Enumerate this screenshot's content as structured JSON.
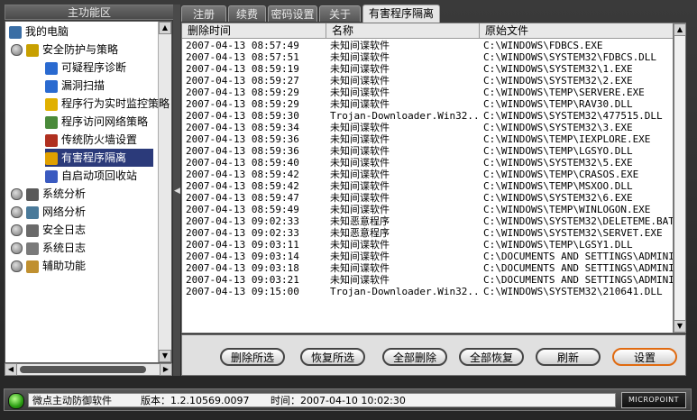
{
  "left_panel": {
    "title": "主功能区",
    "tree": [
      {
        "label": "我的电脑",
        "level": 0,
        "icon": "computer-icon",
        "name": "tree-item-my-computer"
      },
      {
        "label": "安全防护与策略",
        "level": 1,
        "icon": "shield-icon",
        "name": "tree-item-security-policy"
      },
      {
        "label": "可疑程序诊断",
        "level": 2,
        "icon": "magnifier-icon",
        "name": "tree-item-suspicious-diagnosis"
      },
      {
        "label": "漏洞扫描",
        "level": 2,
        "icon": "scan-icon",
        "name": "tree-item-vuln-scan"
      },
      {
        "label": "程序行为实时监控策略",
        "level": 2,
        "icon": "monitor-icon",
        "name": "tree-item-realtime-monitor"
      },
      {
        "label": "程序访问网络策略",
        "level": 2,
        "icon": "network-policy-icon",
        "name": "tree-item-network-policy"
      },
      {
        "label": "传统防火墙设置",
        "level": 2,
        "icon": "firewall-icon",
        "name": "tree-item-firewall"
      },
      {
        "label": "有害程序隔离",
        "level": 2,
        "icon": "quarantine-icon",
        "name": "tree-item-quarantine",
        "selected": true
      },
      {
        "label": "自启动项回收站",
        "level": 2,
        "icon": "recycle-icon",
        "name": "tree-item-startup-recycle"
      },
      {
        "label": "系统分析",
        "level": 1,
        "icon": "system-icon",
        "name": "tree-item-system-analysis"
      },
      {
        "label": "网络分析",
        "level": 1,
        "icon": "network-icon",
        "name": "tree-item-network-analysis"
      },
      {
        "label": "安全日志",
        "level": 1,
        "icon": "log-icon",
        "name": "tree-item-security-log"
      },
      {
        "label": "系统日志",
        "level": 1,
        "icon": "syslog-icon",
        "name": "tree-item-system-log"
      },
      {
        "label": "辅助功能",
        "level": 1,
        "icon": "tools-icon",
        "name": "tree-item-aux"
      }
    ]
  },
  "tabs": [
    {
      "label": "注册"
    },
    {
      "label": "续费"
    },
    {
      "label": "密码设置"
    },
    {
      "label": "关于"
    },
    {
      "label": "有害程序隔离",
      "active": true
    }
  ],
  "table": {
    "columns": [
      "删除时间",
      "名称",
      "原始文件"
    ],
    "rows": [
      [
        "2007-04-13 08:57:49",
        "未知间谍软件",
        "C:\\WINDOWS\\FDBCS.EXE"
      ],
      [
        "2007-04-13 08:57:51",
        "未知间谍软件",
        "C:\\WINDOWS\\SYSTEM32\\FDBCS.DLL"
      ],
      [
        "2007-04-13 08:59:19",
        "未知间谍软件",
        "C:\\WINDOWS\\SYSTEM32\\1.EXE"
      ],
      [
        "2007-04-13 08:59:27",
        "未知间谍软件",
        "C:\\WINDOWS\\SYSTEM32\\2.EXE"
      ],
      [
        "2007-04-13 08:59:29",
        "未知间谍软件",
        "C:\\WINDOWS\\TEMP\\SERVERE.EXE"
      ],
      [
        "2007-04-13 08:59:29",
        "未知间谍软件",
        "C:\\WINDOWS\\TEMP\\RAV30.DLL"
      ],
      [
        "2007-04-13 08:59:30",
        "Trojan-Downloader.Win32...",
        "C:\\WINDOWS\\SYSTEM32\\477515.DLL"
      ],
      [
        "2007-04-13 08:59:34",
        "未知间谍软件",
        "C:\\WINDOWS\\SYSTEM32\\3.EXE"
      ],
      [
        "2007-04-13 08:59:36",
        "未知间谍软件",
        "C:\\WINDOWS\\TEMP\\IEXPLORE.EXE"
      ],
      [
        "2007-04-13 08:59:36",
        "未知间谍软件",
        "C:\\WINDOWS\\TEMP\\LGSYO.DLL"
      ],
      [
        "2007-04-13 08:59:40",
        "未知间谍软件",
        "C:\\WINDOWS\\SYSTEM32\\5.EXE"
      ],
      [
        "2007-04-13 08:59:42",
        "未知间谍软件",
        "C:\\WINDOWS\\TEMP\\CRASOS.EXE"
      ],
      [
        "2007-04-13 08:59:42",
        "未知间谍软件",
        "C:\\WINDOWS\\TEMP\\MSXOO.DLL"
      ],
      [
        "2007-04-13 08:59:47",
        "未知间谍软件",
        "C:\\WINDOWS\\SYSTEM32\\6.EXE"
      ],
      [
        "2007-04-13 08:59:49",
        "未知间谍软件",
        "C:\\WINDOWS\\TEMP\\WINLOGON.EXE"
      ],
      [
        "2007-04-13 09:02:33",
        "未知恶意程序",
        "C:\\WINDOWS\\SYSTEM32\\DELETEME.BAT"
      ],
      [
        "2007-04-13 09:02:33",
        "未知恶意程序",
        "C:\\WINDOWS\\SYSTEM32\\SERVET.EXE"
      ],
      [
        "2007-04-13 09:03:11",
        "未知间谍软件",
        "C:\\WINDOWS\\TEMP\\LGSY1.DLL"
      ],
      [
        "2007-04-13 09:03:14",
        "未知间谍软件",
        "C:\\DOCUMENTS AND SETTINGS\\ADMINISTI"
      ],
      [
        "2007-04-13 09:03:18",
        "未知间谍软件",
        "C:\\DOCUMENTS AND SETTINGS\\ADMINISTI"
      ],
      [
        "2007-04-13 09:03:21",
        "未知间谍软件",
        "C:\\DOCUMENTS AND SETTINGS\\ADMINISTI"
      ],
      [
        "2007-04-13 09:15:00",
        "Trojan-Downloader.Win32...",
        "C:\\WINDOWS\\SYSTEM32\\210641.DLL"
      ]
    ]
  },
  "buttons": [
    {
      "label": "删除所选",
      "name": "delete-selected-button"
    },
    {
      "label": "恢复所选",
      "name": "restore-selected-button"
    },
    {
      "label": "全部删除",
      "name": "delete-all-button"
    },
    {
      "label": "全部恢复",
      "name": "restore-all-button"
    },
    {
      "label": "刷新",
      "name": "refresh-button"
    },
    {
      "label": "设置",
      "name": "settings-button",
      "hot": true
    }
  ],
  "status": {
    "product": "微点主动防御软件",
    "version": "版本：1.2.10569.0097",
    "time": "时间：2007-04-10 10:02:30",
    "logo": "MICROPOINT"
  },
  "colors": {
    "selection": "#2b3a7a",
    "hot_button_border": "#e06a10",
    "status_led": "#2a9c12"
  }
}
